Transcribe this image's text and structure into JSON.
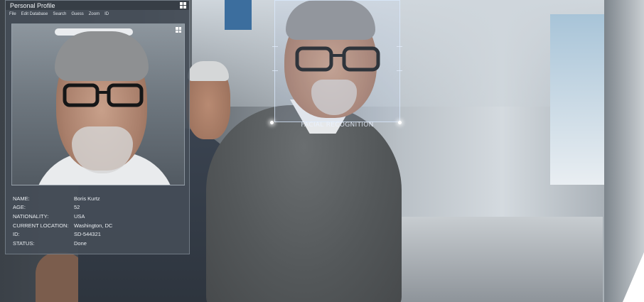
{
  "window": {
    "title": "Personal Profile",
    "menu": [
      "File",
      "Edit Database",
      "Search",
      "Guess",
      "Zoom",
      "ID"
    ]
  },
  "profile": {
    "fields": [
      {
        "label": "NAME:",
        "value": "Boris Kurtz"
      },
      {
        "label": "AGE:",
        "value": "52"
      },
      {
        "label": "NATIONALITY:",
        "value": "USA"
      },
      {
        "label": "CURRENT LOCATION:",
        "value": "Washington, DC"
      },
      {
        "label": "ID:",
        "value": "SD-544321"
      },
      {
        "label": "STATUS:",
        "value": "Done"
      }
    ]
  },
  "overlay": {
    "caption": "FACIAL RECOGNITION"
  },
  "icons": {
    "title_icon": "grid-icon",
    "photo_icon": "grid-icon"
  },
  "colors": {
    "panel": "#464e58",
    "titlebar": "#373d46",
    "text": "#e9edf1",
    "frame_line": "#dcebff"
  }
}
